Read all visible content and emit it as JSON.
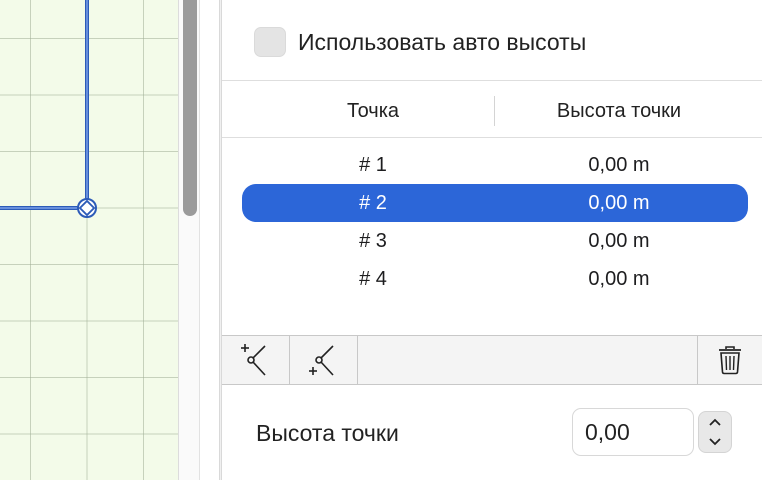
{
  "auto_heights": {
    "label": "Использовать авто высоты",
    "checked": false
  },
  "table": {
    "columns": [
      "Точка",
      "Высота точки"
    ],
    "rows": [
      {
        "point": "# 1",
        "height": "0,00 m"
      },
      {
        "point": "# 2",
        "height": "0,00 m"
      },
      {
        "point": "# 3",
        "height": "0,00 m"
      },
      {
        "point": "# 4",
        "height": "0,00 m"
      }
    ],
    "selected_index": 1
  },
  "toolbar": {
    "add_before_icon": "add-point-before-icon",
    "add_after_icon": "add-point-after-icon",
    "delete_icon": "trash-icon"
  },
  "point_height": {
    "label": "Высота точки",
    "value": "0,00"
  },
  "colors": {
    "selection": "#2c66d8",
    "canvas_bg": "#f3fbe9",
    "path": "#2c5bb8"
  }
}
